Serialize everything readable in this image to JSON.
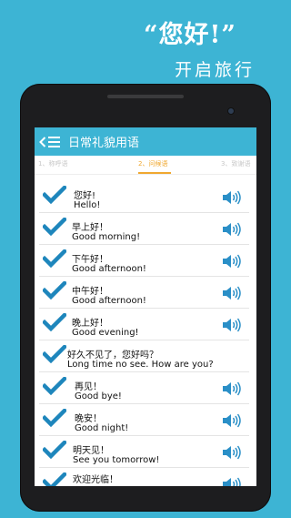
{
  "promo": {
    "quote": "“您好!”",
    "subtitle": "开启旅行"
  },
  "app": {
    "title": "日常礼貌用语",
    "accent_color": "#3db4d4",
    "tab_accent_color": "#f0a830"
  },
  "tabs": [
    {
      "label": "1、称呼语",
      "active": false
    },
    {
      "label": "2、问候语",
      "active": true
    },
    {
      "label": "3、致谢语",
      "active": false
    }
  ],
  "phrases": [
    {
      "zh": "您好!",
      "en": "Hello!"
    },
    {
      "zh": "早上好！",
      "en": "Good morning!"
    },
    {
      "zh": "下午好！",
      "en": "Good afternoon!"
    },
    {
      "zh": "中午好！",
      "en": "Good afternoon!"
    },
    {
      "zh": "晚上好！",
      "en": "Good evening!"
    },
    {
      "zh": "好久不见了，您好吗？",
      "en": "Long time no see. How are you?"
    },
    {
      "zh": "再见！",
      "en": "Good bye!"
    },
    {
      "zh": "晚安！",
      "en": "Good night!"
    },
    {
      "zh": "明天见！",
      "en": "See you tomorrow!"
    },
    {
      "zh": "欢迎光临！",
      "en": ""
    }
  ]
}
